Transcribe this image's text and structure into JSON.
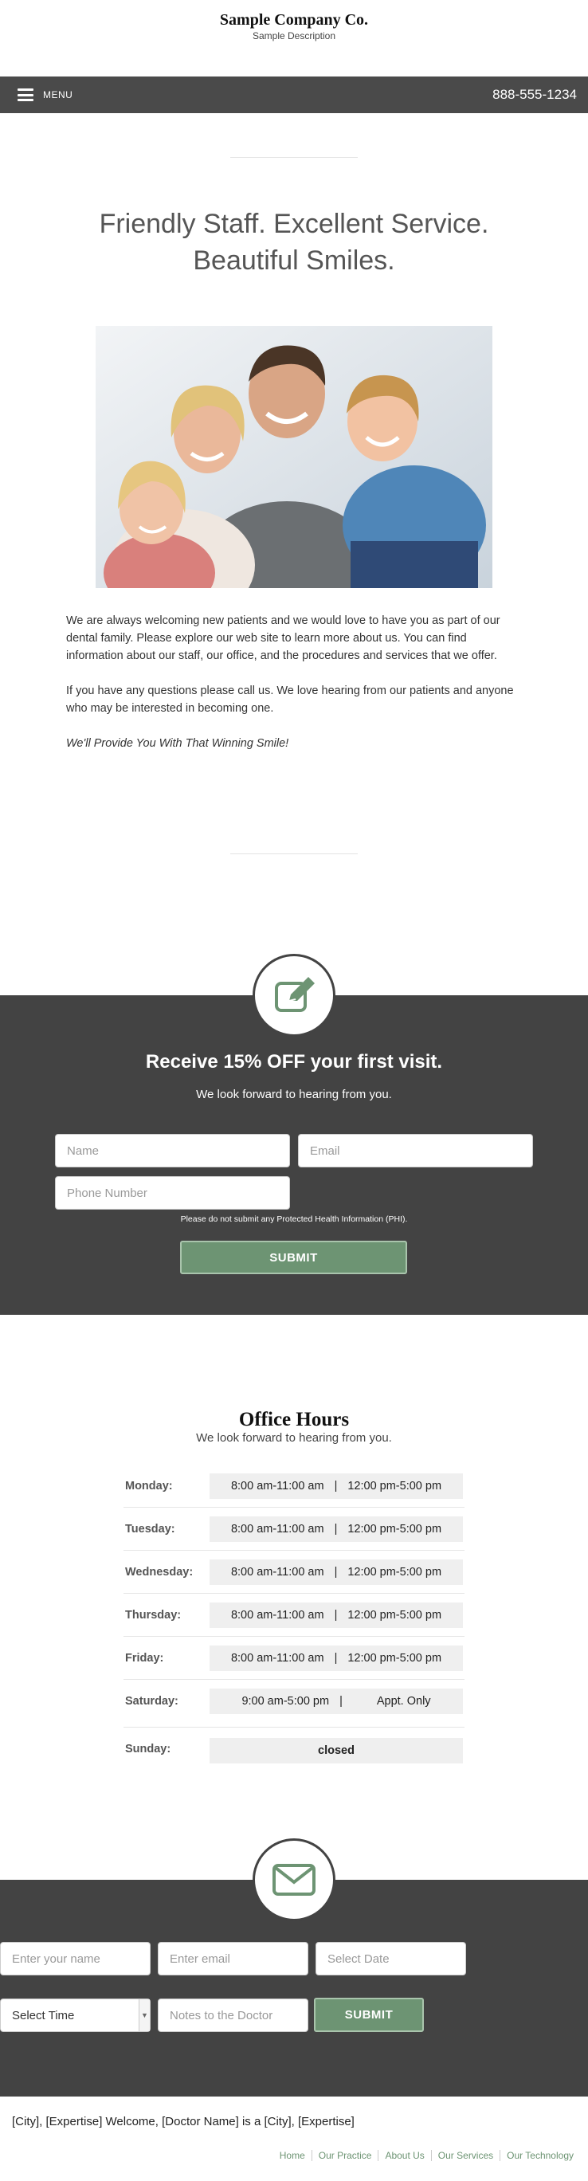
{
  "header": {
    "company_name": "Sample Company Co.",
    "description": "Sample Description"
  },
  "nav": {
    "menu_label": "MENU",
    "phone": "888-555-1234"
  },
  "hero": {
    "headline_line1": "Friendly Staff. Excellent Service.",
    "headline_line2": "Beautiful Smiles."
  },
  "intro": {
    "paragraph1": "We are always welcoming new patients and we would love to have you as part of our dental family. Please explore our web site to learn more about us. You can find information about our staff, our office, and the procedures and services that we offer.",
    "paragraph2": "If you have any questions please call us. We love hearing from our patients and anyone who may be interested in becoming one.",
    "slogan": "We'll Provide You With That Winning Smile!"
  },
  "promo": {
    "icon": "edit-icon",
    "title": "Receive 15% OFF your first visit.",
    "subtitle": "We look forward to hearing from you.",
    "name_placeholder": "Name",
    "email_placeholder": "Email",
    "phone_placeholder": "Phone Number",
    "phi_notice": "Please do not submit any Protected Health Information (PHI).",
    "submit_label": "SUBMIT"
  },
  "hours": {
    "title": "Office Hours",
    "subtitle": "We look forward to hearing from you.",
    "separator": "|",
    "rows": [
      {
        "day": "Monday:",
        "morning": "8:00 am-11:00 am",
        "afternoon": "12:00 pm-5:00 pm"
      },
      {
        "day": "Tuesday:",
        "morning": "8:00 am-11:00 am",
        "afternoon": "12:00 pm-5:00 pm"
      },
      {
        "day": "Wednesday:",
        "morning": "8:00 am-11:00 am",
        "afternoon": "12:00 pm-5:00 pm"
      },
      {
        "day": "Thursday:",
        "morning": "8:00 am-11:00 am",
        "afternoon": "12:00 pm-5:00 pm"
      },
      {
        "day": "Friday:",
        "morning": "8:00 am-11:00 am",
        "afternoon": "12:00 pm-5:00 pm"
      },
      {
        "day": "Saturday:",
        "morning": "9:00 am-5:00 pm",
        "afternoon": "Appt. Only"
      },
      {
        "day": "Sunday:",
        "value": "closed"
      }
    ]
  },
  "contact": {
    "icon": "envelope-icon",
    "name_placeholder": "Enter your name",
    "email_placeholder": "Enter email",
    "date_placeholder": "Select Date",
    "time_selected": "Select Time",
    "notes_placeholder": "Notes to the Doctor",
    "submit_label": "SUBMIT"
  },
  "footer": {
    "text": "[City], [Expertise] Welcome, [Doctor Name] is a [City], [Expertise]",
    "links": [
      "Home",
      "Our Practice",
      "About Us",
      "Our Services",
      "Our Technology"
    ]
  },
  "colors": {
    "accent_green": "#6d9473",
    "dark_band": "#434343",
    "nav_bar": "#4a4a4a"
  }
}
